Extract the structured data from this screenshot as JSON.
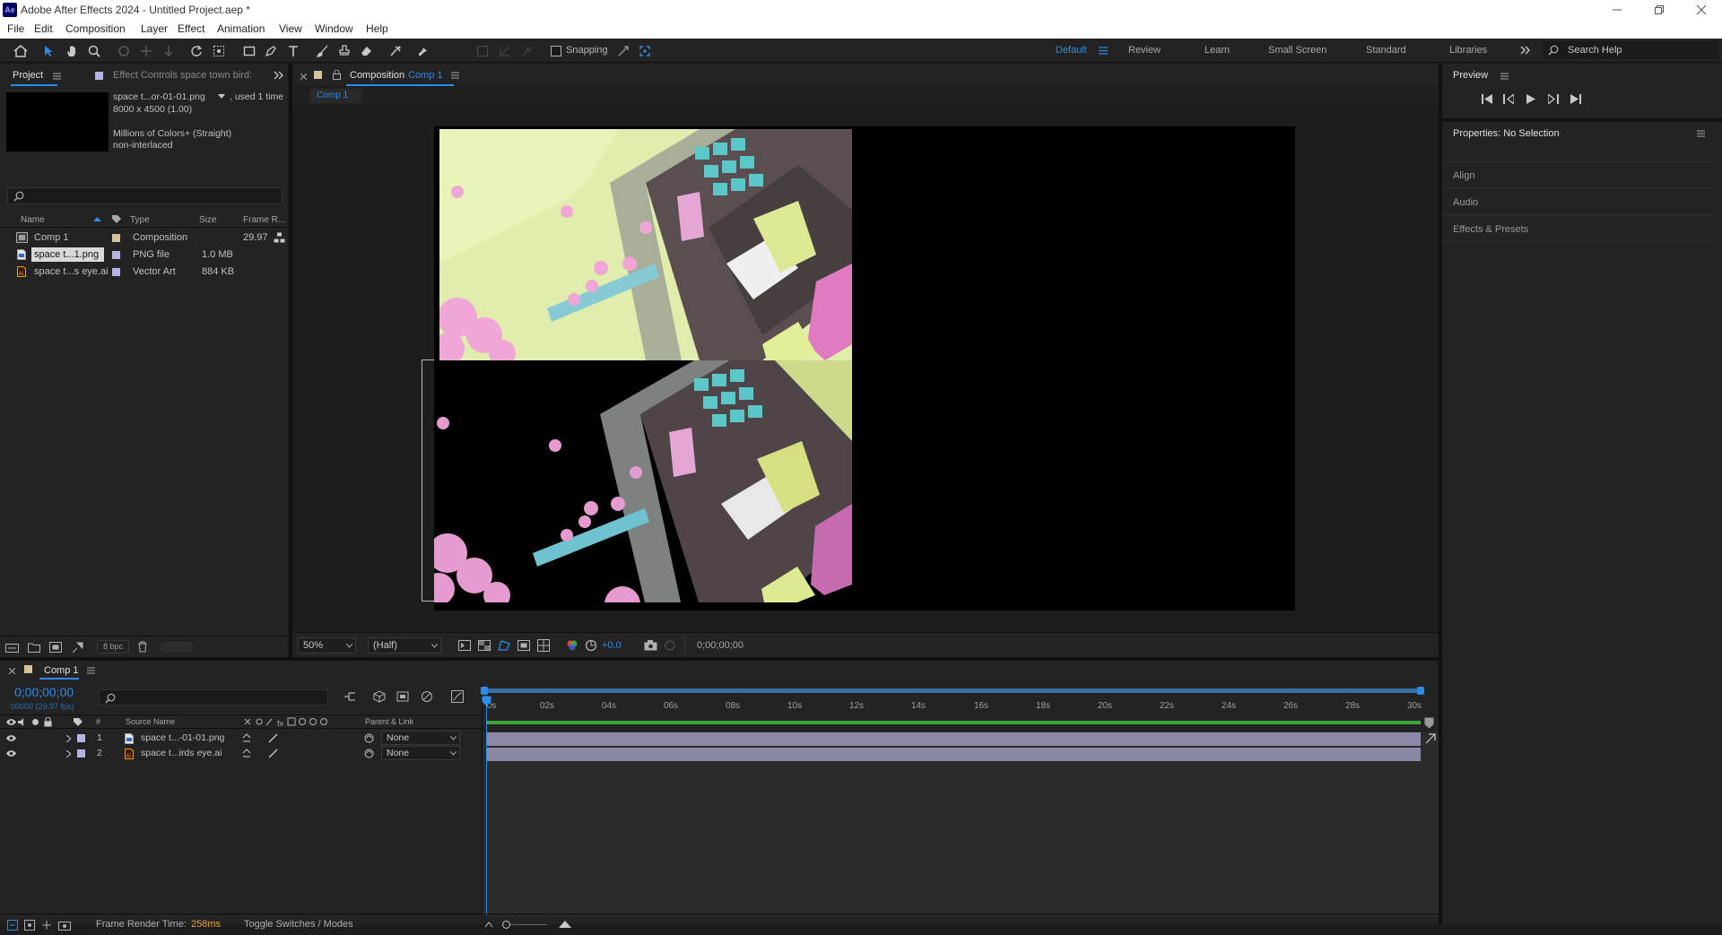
{
  "app": {
    "logo": "Ae",
    "window_title": "Adobe After Effects 2024 - Untitled Project.aep *"
  },
  "menu": [
    "File",
    "Edit",
    "Composition",
    "Layer",
    "Effect",
    "Animation",
    "View",
    "Window",
    "Help"
  ],
  "toolbar": {
    "snapping_label": "Snapping",
    "workspaces": [
      "Default",
      "Review",
      "Learn",
      "Small Screen",
      "Standard",
      "Libraries"
    ],
    "active_workspace": "Default",
    "search_placeholder": "Search Help"
  },
  "project_panel": {
    "tab_label": "Project",
    "effect_controls_tab": "Effect Controls space town bird:",
    "selected_item": {
      "name": "space t...or-01-01.png",
      "usage": ", used 1 time",
      "dimensions": "8000 x 4500 (1.00)",
      "colors": "Millions of Colors+ (Straight)",
      "interlace": "non-interlaced"
    },
    "search_placeholder": "",
    "columns": [
      "Name",
      "Type",
      "Size",
      "Frame R..."
    ],
    "items": [
      {
        "name": "Comp 1",
        "type": "Composition",
        "size": "",
        "frame_rate": "29.97",
        "label_color": "#d7c39b",
        "icon": "composition-icon"
      },
      {
        "name": "space t...1.png",
        "type": "PNG file",
        "size": "1.0 MB",
        "frame_rate": "",
        "label_color": "#b4b4e6",
        "icon": "png-file-icon"
      },
      {
        "name": "space t...s eye.ai",
        "type": "Vector Art",
        "size": "884 KB",
        "frame_rate": "",
        "label_color": "#b4b4e6",
        "icon": "illustrator-file-icon"
      }
    ],
    "bpc_label": "8 bpc"
  },
  "composition_panel": {
    "tab_prefix": "Composition",
    "tab_comp_name": "Comp 1",
    "subtab": "Comp 1",
    "zoom": "50%",
    "resolution": "(Half)",
    "exposure": "+0.0",
    "timecode": "0;00;00;00"
  },
  "preview_panel": {
    "title": "Preview"
  },
  "properties_panel": {
    "title": "Properties: No Selection",
    "sections": [
      "Align",
      "Audio",
      "Effects & Presets"
    ]
  },
  "timeline": {
    "tab_label": "Comp 1",
    "current_time": "0;00;00;00",
    "fps_sub": "00000 (29.97 fps)",
    "search_placeholder": "",
    "col_hash": "#",
    "col_source": "Source Name",
    "col_parent": "Parent & Link",
    "layers": [
      {
        "num": "1",
        "name": "space t...-01-01.png",
        "parent": "None",
        "label_color": "#b4b4e6",
        "icon": "png-file-icon"
      },
      {
        "num": "2",
        "name": "space t...irds eye.ai",
        "parent": "None",
        "label_color": "#b4b4e6",
        "icon": "illustrator-file-icon"
      }
    ],
    "ruler": [
      "0s",
      "02s",
      "04s",
      "06s",
      "08s",
      "10s",
      "12s",
      "14s",
      "16s",
      "18s",
      "20s",
      "22s",
      "24s",
      "26s",
      "28s",
      "30s"
    ],
    "playhead_fraction": 0.0
  },
  "status_bar": {
    "render_label": "Frame Render Time:",
    "render_value": "258ms",
    "toggle_label": "Toggle Switches / Modes"
  },
  "colors": {
    "accent_blue": "#2d8ceb",
    "render_time": "#e8a33a",
    "workarea_green": "#38a83c"
  }
}
